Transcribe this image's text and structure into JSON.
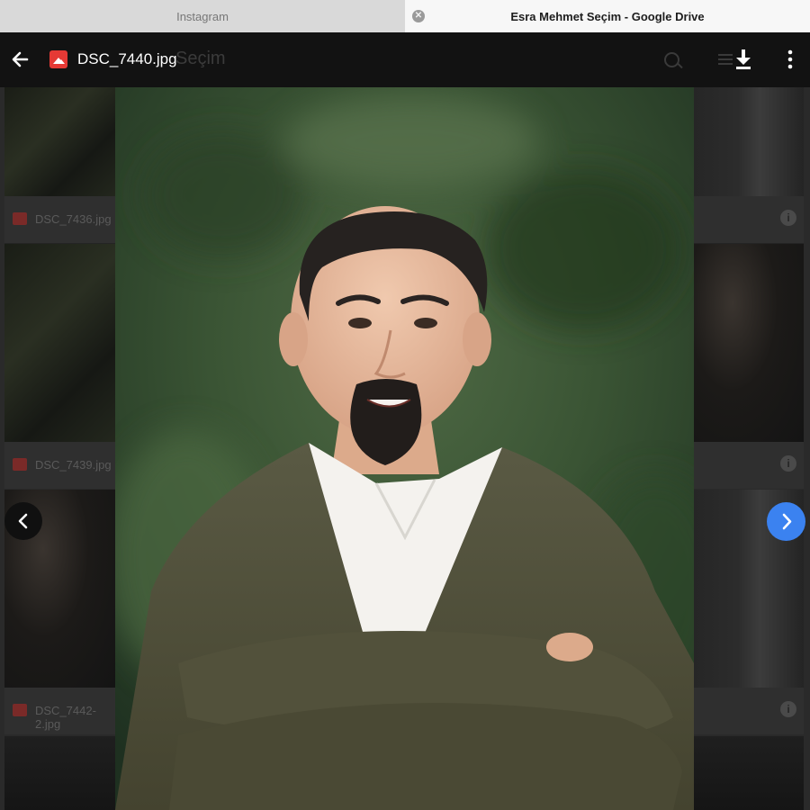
{
  "browser": {
    "tabs": [
      {
        "title": "Instagram",
        "active": false
      },
      {
        "title": "Esra Mehmet Seçim - Google Drive",
        "active": true
      }
    ]
  },
  "drive_background": {
    "folder_title": "Seçim",
    "files": [
      {
        "name": "DSC_7436.jpg"
      },
      {
        "name": "DSC_7439.jpg"
      },
      {
        "name": "DSC_7442-2.jpg"
      }
    ]
  },
  "viewer": {
    "file_name": "DSC_7440.jpg",
    "icons": {
      "back": "arrow-left-icon",
      "file_type": "image-file-icon",
      "download": "download-icon",
      "more": "more-vertical-icon",
      "prev": "chevron-left-icon",
      "next": "chevron-right-icon"
    },
    "accent_color": "#3b82f0"
  }
}
